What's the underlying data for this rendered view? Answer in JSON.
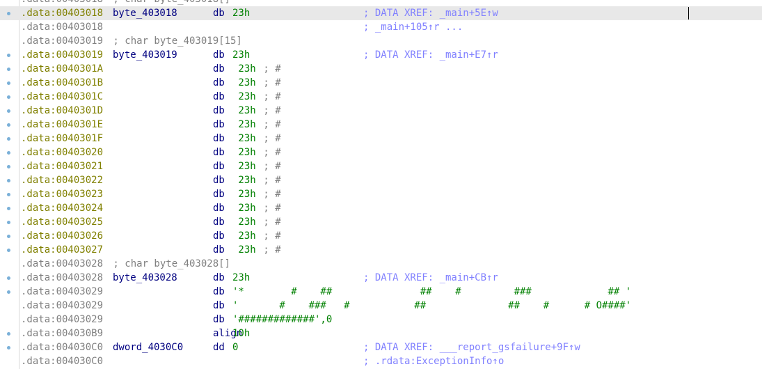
{
  "disasm": {
    "lines": [
      {
        "dot": false,
        "hl": false,
        "addr": ".data:00403018",
        "addr_kind": "gray",
        "label": "",
        "mnem": "",
        "op": "",
        "op_kind": "",
        "inline": " ; char byte_403018[]",
        "xref": ""
      },
      {
        "dot": true,
        "hl": true,
        "addr": ".data:00403018",
        "addr_kind": "olive",
        "label": "byte_403018",
        "mnem": "db",
        "op": "23h",
        "op_kind": "num",
        "inline": "",
        "xref": "; DATA XREF: _main+5E↑w"
      },
      {
        "dot": false,
        "hl": false,
        "addr": ".data:00403018",
        "addr_kind": "gray",
        "label": "",
        "mnem": "",
        "op": "",
        "op_kind": "",
        "inline": "",
        "xref": "; _main+105↑r ..."
      },
      {
        "dot": false,
        "hl": false,
        "addr": ".data:00403019",
        "addr_kind": "gray",
        "label": "",
        "mnem": "",
        "op": "",
        "op_kind": "",
        "inline": " ; char byte_403019[15]",
        "xref": ""
      },
      {
        "dot": true,
        "hl": false,
        "addr": ".data:00403019",
        "addr_kind": "olive",
        "label": "byte_403019",
        "mnem": "db",
        "op": "23h",
        "op_kind": "num",
        "inline": "",
        "xref": "; DATA XREF: _main+E7↑r"
      },
      {
        "dot": true,
        "hl": false,
        "addr": ".data:0040301A",
        "addr_kind": "olive",
        "label": "",
        "mnem": "db",
        "op": " 23h",
        "op_kind": "num",
        "inline": " ; #",
        "xref": ""
      },
      {
        "dot": true,
        "hl": false,
        "addr": ".data:0040301B",
        "addr_kind": "olive",
        "label": "",
        "mnem": "db",
        "op": " 23h",
        "op_kind": "num",
        "inline": " ; #",
        "xref": ""
      },
      {
        "dot": true,
        "hl": false,
        "addr": ".data:0040301C",
        "addr_kind": "olive",
        "label": "",
        "mnem": "db",
        "op": " 23h",
        "op_kind": "num",
        "inline": " ; #",
        "xref": ""
      },
      {
        "dot": true,
        "hl": false,
        "addr": ".data:0040301D",
        "addr_kind": "olive",
        "label": "",
        "mnem": "db",
        "op": " 23h",
        "op_kind": "num",
        "inline": " ; #",
        "xref": ""
      },
      {
        "dot": true,
        "hl": false,
        "addr": ".data:0040301E",
        "addr_kind": "olive",
        "label": "",
        "mnem": "db",
        "op": " 23h",
        "op_kind": "num",
        "inline": " ; #",
        "xref": ""
      },
      {
        "dot": true,
        "hl": false,
        "addr": ".data:0040301F",
        "addr_kind": "olive",
        "label": "",
        "mnem": "db",
        "op": " 23h",
        "op_kind": "num",
        "inline": " ; #",
        "xref": ""
      },
      {
        "dot": true,
        "hl": false,
        "addr": ".data:00403020",
        "addr_kind": "olive",
        "label": "",
        "mnem": "db",
        "op": " 23h",
        "op_kind": "num",
        "inline": " ; #",
        "xref": ""
      },
      {
        "dot": true,
        "hl": false,
        "addr": ".data:00403021",
        "addr_kind": "olive",
        "label": "",
        "mnem": "db",
        "op": " 23h",
        "op_kind": "num",
        "inline": " ; #",
        "xref": ""
      },
      {
        "dot": true,
        "hl": false,
        "addr": ".data:00403022",
        "addr_kind": "olive",
        "label": "",
        "mnem": "db",
        "op": " 23h",
        "op_kind": "num",
        "inline": " ; #",
        "xref": ""
      },
      {
        "dot": true,
        "hl": false,
        "addr": ".data:00403023",
        "addr_kind": "olive",
        "label": "",
        "mnem": "db",
        "op": " 23h",
        "op_kind": "num",
        "inline": " ; #",
        "xref": ""
      },
      {
        "dot": true,
        "hl": false,
        "addr": ".data:00403024",
        "addr_kind": "olive",
        "label": "",
        "mnem": "db",
        "op": " 23h",
        "op_kind": "num",
        "inline": " ; #",
        "xref": ""
      },
      {
        "dot": true,
        "hl": false,
        "addr": ".data:00403025",
        "addr_kind": "olive",
        "label": "",
        "mnem": "db",
        "op": " 23h",
        "op_kind": "num",
        "inline": " ; #",
        "xref": ""
      },
      {
        "dot": true,
        "hl": false,
        "addr": ".data:00403026",
        "addr_kind": "olive",
        "label": "",
        "mnem": "db",
        "op": " 23h",
        "op_kind": "num",
        "inline": " ; #",
        "xref": ""
      },
      {
        "dot": true,
        "hl": false,
        "addr": ".data:00403027",
        "addr_kind": "olive",
        "label": "",
        "mnem": "db",
        "op": " 23h",
        "op_kind": "num",
        "inline": " ; #",
        "xref": ""
      },
      {
        "dot": false,
        "hl": false,
        "addr": ".data:00403028",
        "addr_kind": "gray",
        "label": "",
        "mnem": "",
        "op": "",
        "op_kind": "",
        "inline": " ; char byte_403028[]",
        "xref": ""
      },
      {
        "dot": true,
        "hl": false,
        "addr": ".data:00403028",
        "addr_kind": "gray",
        "label": "byte_403028",
        "mnem": "db",
        "op": "23h",
        "op_kind": "num",
        "inline": "",
        "xref": "; DATA XREF: _main+CB↑r"
      },
      {
        "dot": true,
        "hl": false,
        "addr": ".data:00403029",
        "addr_kind": "gray",
        "label": "",
        "mnem": "db",
        "op": "'*        #    ##               ##    #         ###             ## '",
        "op_kind": "str",
        "inline": "",
        "xref": ""
      },
      {
        "dot": false,
        "hl": false,
        "addr": ".data:00403029",
        "addr_kind": "gray",
        "label": "",
        "mnem": "db",
        "op": "'       #    ###   #           ##              ##    #      # O####'",
        "op_kind": "str",
        "inline": "",
        "xref": ""
      },
      {
        "dot": false,
        "hl": false,
        "addr": ".data:00403029",
        "addr_kind": "gray",
        "label": "",
        "mnem": "db",
        "op": "'#############',0",
        "op_kind": "str",
        "inline": "",
        "xref": ""
      },
      {
        "dot": true,
        "hl": false,
        "addr": ".data:004030B9",
        "addr_kind": "gray",
        "label": "",
        "mnem": "align",
        "op": "10h",
        "op_kind": "num",
        "inline": "",
        "xref": ""
      },
      {
        "dot": true,
        "hl": false,
        "addr": ".data:004030C0",
        "addr_kind": "gray",
        "label": "dword_4030C0",
        "mnem": "dd",
        "op": "0",
        "op_kind": "num",
        "inline": "",
        "xref": "; DATA XREF: ___report_gsfailure+9F↑w"
      },
      {
        "dot": false,
        "hl": false,
        "addr": ".data:004030C0",
        "addr_kind": "gray",
        "label": "",
        "mnem": "",
        "op": "",
        "op_kind": "",
        "inline": "",
        "xref": "; .rdata:ExceptionInfo↑o"
      }
    ]
  },
  "colors": {
    "address_olive": "#808000",
    "address_gray": "#808080",
    "name_navy": "#000080",
    "number_green": "#008000",
    "xref_comment": "#8080ff",
    "highlight_row": "#e8e8e8",
    "breakpoint_dot": "#7ab0d8"
  }
}
